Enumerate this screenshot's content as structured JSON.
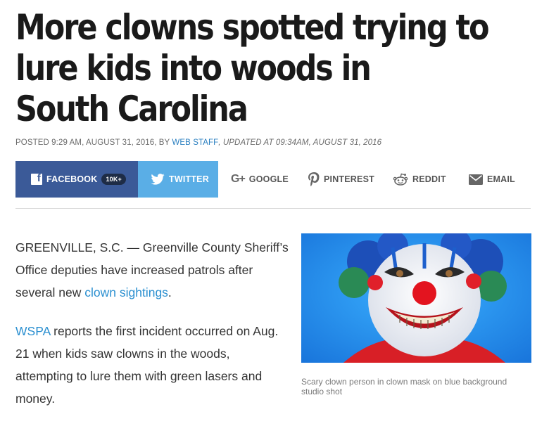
{
  "article": {
    "headline_lines": [
      "More clowns spotted trying to",
      "lure kids into woods in",
      "South Carolina"
    ],
    "byline": {
      "posted": "POSTED 9:29 AM, AUGUST 31, 2016, BY ",
      "author": "WEB STAFF",
      "updated": ", UPDATED AT 09:34AM, AUGUST 31, 2016"
    },
    "paragraph1": {
      "text": "GREENVILLE, S.C. — Greenville County Sheriff’s Office deputies have increased patrols after several new ",
      "link": "clown sightings",
      "end": "."
    },
    "paragraph2": {
      "link": "WSPA",
      "text": " reports the first incident occurred on Aug. 21 when kids saw clowns in the woods, attempting to lure them with green lasers and money."
    },
    "image_caption": "Scary clown person in clown mask on blue background studio shot"
  },
  "share": {
    "facebook": "FACEBOOK",
    "facebook_count": "10K+",
    "twitter": "TWITTER",
    "google": "GOOGLE",
    "pinterest": "PINTEREST",
    "reddit": "REDDIT",
    "email": "EMAIL"
  },
  "colors": {
    "facebook": "#3b5a98",
    "twitter": "#5aaee6",
    "link": "#2a8fd0",
    "photo_background": "#1c8fe3"
  },
  "icons": [
    "facebook-icon",
    "twitter-icon",
    "google-plus-icon",
    "pinterest-icon",
    "reddit-icon",
    "email-icon"
  ]
}
